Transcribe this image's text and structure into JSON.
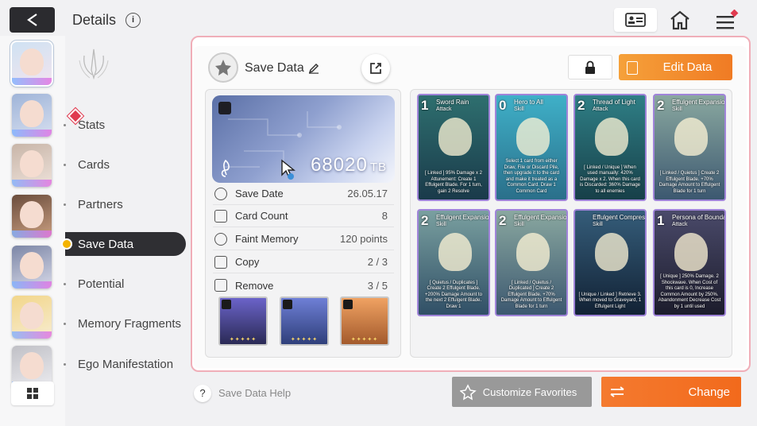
{
  "header": {
    "title": "Details"
  },
  "nav": {
    "items": [
      {
        "label": "Stats"
      },
      {
        "label": "Cards"
      },
      {
        "label": "Partners"
      },
      {
        "label": "Save Data"
      },
      {
        "label": "Potential"
      },
      {
        "label": "Memory Fragments"
      },
      {
        "label": "Ego Manifestation"
      }
    ],
    "active": "Save Data"
  },
  "save_panel": {
    "title": "Save Data",
    "edit_label": "Edit Data",
    "tb_value": "68020",
    "tb_unit": "TB"
  },
  "stats": [
    {
      "label": "Save Date",
      "value": "26.05.17",
      "icon": "clock-icon"
    },
    {
      "label": "Card Count",
      "value": "8",
      "icon": "cards-icon"
    },
    {
      "label": "Faint Memory",
      "value": "120 points",
      "icon": "memory-icon"
    },
    {
      "label": "Copy",
      "value": "2 / 3",
      "icon": "copy-icon"
    },
    {
      "label": "Remove",
      "value": "3 / 5",
      "icon": "remove-icon"
    }
  ],
  "equipment": [
    {
      "name": "weapon",
      "stars": "✦✦✦✦✦",
      "colors": [
        "#6b63c9",
        "#2a2a55"
      ]
    },
    {
      "name": "armor",
      "stars": "✦✦✦✦✦",
      "colors": [
        "#6e7fd6",
        "#2f3f7a"
      ]
    },
    {
      "name": "accessory",
      "stars": "✦✦✦✦✦",
      "colors": [
        "#f0a262",
        "#a35a2c"
      ]
    }
  ],
  "deck": [
    {
      "cost": "1",
      "name": "Sword Rain",
      "type": "Attack",
      "desc": "[ Linked ] 95% Damage x 2 Attunement: Create 1 Effulgent Blade. For 1 turn, gain 2 Resolve",
      "colors": [
        "#2e6f6f",
        "#1a3a4a"
      ]
    },
    {
      "cost": "0",
      "name": "Hero to All",
      "type": "Skill",
      "desc": "Select 1 card from either Draw, File or Discard Pile, then upgrade it to the card and make it treated as a Common Card. Draw 1 Common Card",
      "colors": [
        "#3fb0c8",
        "#2a6f8a"
      ]
    },
    {
      "cost": "2",
      "name": "Thread of Light",
      "type": "Attack",
      "desc": "[ Linked / Unique ] When used manually: 420% Damage x 2. When this card is Discarded: 360% Damage to all enemies",
      "colors": [
        "#2f7f86",
        "#173f48"
      ]
    },
    {
      "cost": "2",
      "name": "Effulgent Expansion",
      "type": "Skill",
      "desc": "[ Linked / Quietus ] Create 2 Effulgent Blade. +70% Damage Amount to Effulgent Blade for 1 turn",
      "colors": [
        "#8aa8a0",
        "#3c5870"
      ]
    },
    {
      "cost": "2",
      "name": "Effulgent Expansion",
      "type": "Skill",
      "desc": "[ Quietus / Duplicates ] Create 2 Effulgent Blade. +200% Damage Amount to the next 2 Effulgent Blade. Draw 1",
      "colors": [
        "#7aa0a0",
        "#304f66"
      ]
    },
    {
      "cost": "2",
      "name": "Effulgent Expansion",
      "type": "Skill",
      "desc": "[ Linked / Quietus / Duplicated ] Create 2 Effulgent Blade. +70% Damage Amount to Effulgent Blade for 1 turn",
      "colors": [
        "#8aa8a0",
        "#3c5870"
      ]
    },
    {
      "cost": "",
      "name": "Effulgent Compression",
      "type": "Skill",
      "desc": "[ Unique / Linked ] Retrieve 3. When moved to Graveyard, 1 Effulgent Light",
      "colors": [
        "#355d7a",
        "#122235"
      ]
    },
    {
      "cost": "1",
      "name": "Persona of Boundary",
      "type": "Attack",
      "desc": "[ Unique ] 250% Damage. 2 Shockwave. When Cost of this card is 0, Increase Common Amount by 250%. Abandonment Decrease Cost by 1 until used",
      "colors": [
        "#4a4a6a",
        "#1c1c2c"
      ]
    }
  ],
  "footer": {
    "help_label": "Save Data Help",
    "favorites_label": "Customize Favorites",
    "change_label": "Change"
  },
  "colors": {
    "accent_orange": "#f26a1c",
    "nav_active": "#2f2f33",
    "alert_red": "#e03a4f"
  }
}
